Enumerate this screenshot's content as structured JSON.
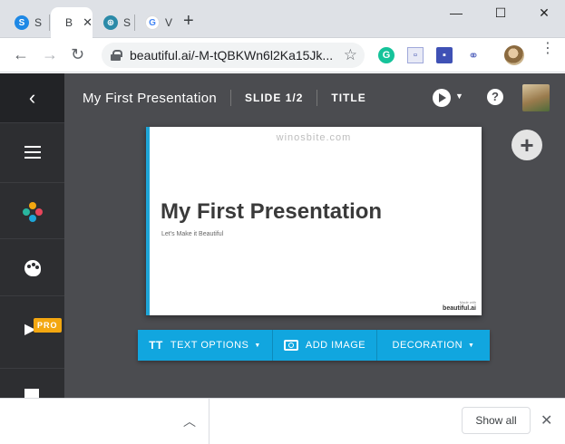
{
  "browser": {
    "tabs": [
      {
        "favicon": "S",
        "favicon_color": "#1e88e5",
        "title": "S"
      },
      {
        "favicon": "B",
        "favicon_color": "#1ea6d8",
        "title": "B"
      },
      {
        "favicon": "⊕",
        "favicon_color": "#2b8aa8",
        "title": "S"
      },
      {
        "favicon": "G",
        "favicon_color": "#ffffff",
        "title": "V"
      }
    ],
    "active_tab_close": "✕",
    "new_tab_label": "+",
    "window_controls": {
      "minimize": "—",
      "maximize": "☐",
      "close": "✕"
    },
    "url": "beautiful.ai/-M-tQBKWn6l2Ka15Jk...",
    "extensions": [
      "grammarly-icon",
      "screenshot-icon",
      "save-icon",
      "link-icon"
    ]
  },
  "app": {
    "presentation_title": "My First Presentation",
    "slide_indicator": "SLIDE 1/2",
    "layout_label": "TITLE",
    "help_label": "?",
    "add_slide_label": "+",
    "pro_badge": "PRO",
    "slide": {
      "watermark": "winosbite.com",
      "heading": "My First Presentation",
      "subheading": "Let's Make it Beautiful",
      "brand": "beautiful.ai",
      "brand_caption": "Made with",
      "accent_color": "#1ea6d8"
    },
    "options": [
      {
        "icon": "TT",
        "label": "TEXT OPTIONS",
        "dropdown": true
      },
      {
        "icon": "camera",
        "label": "ADD IMAGE",
        "dropdown": false
      },
      {
        "icon": "",
        "label": "DECORATION",
        "dropdown": true
      }
    ],
    "accent_color": "#11a6df"
  },
  "downloads": {
    "show_all_label": "Show all",
    "close_label": "✕"
  }
}
